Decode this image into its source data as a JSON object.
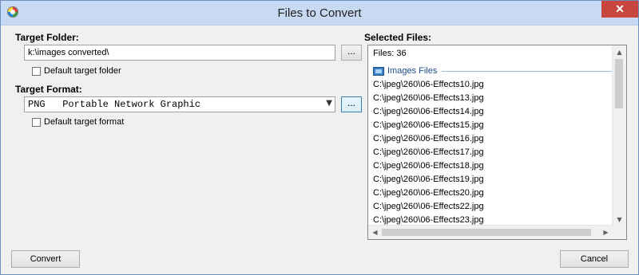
{
  "window": {
    "title": "Files to Convert",
    "close_glyph": "✕",
    "app_icon": "app-logo-icon"
  },
  "target_folder": {
    "label": "Target Folder:",
    "value": "k:\\images converted\\",
    "browse_label": "...",
    "default_checkbox_label": "Default target folder",
    "default_checked": false
  },
  "target_format": {
    "label": "Target Format:",
    "selected": "PNG   Portable Network Graphic",
    "options_label": "...",
    "default_checkbox_label": "Default target format",
    "default_checked": false
  },
  "selected_files": {
    "label": "Selected Files:",
    "count_text": "Files: 36",
    "group_label": "Images Files",
    "items": [
      "C:\\jpeg\\260\\06-Effects10.jpg",
      "C:\\jpeg\\260\\06-Effects13.jpg",
      "C:\\jpeg\\260\\06-Effects14.jpg",
      "C:\\jpeg\\260\\06-Effects15.jpg",
      "C:\\jpeg\\260\\06-Effects16.jpg",
      "C:\\jpeg\\260\\06-Effects17.jpg",
      "C:\\jpeg\\260\\06-Effects18.jpg",
      "C:\\jpeg\\260\\06-Effects19.jpg",
      "C:\\jpeg\\260\\06-Effects20.jpg",
      "C:\\jpeg\\260\\06-Effects22.jpg",
      "C:\\jpeg\\260\\06-Effects23.jpg"
    ]
  },
  "buttons": {
    "convert": "Convert",
    "cancel": "Cancel"
  },
  "colors": {
    "titlebar": "#c8daf3",
    "close": "#c7463d",
    "group_text": "#1e4e8c"
  }
}
